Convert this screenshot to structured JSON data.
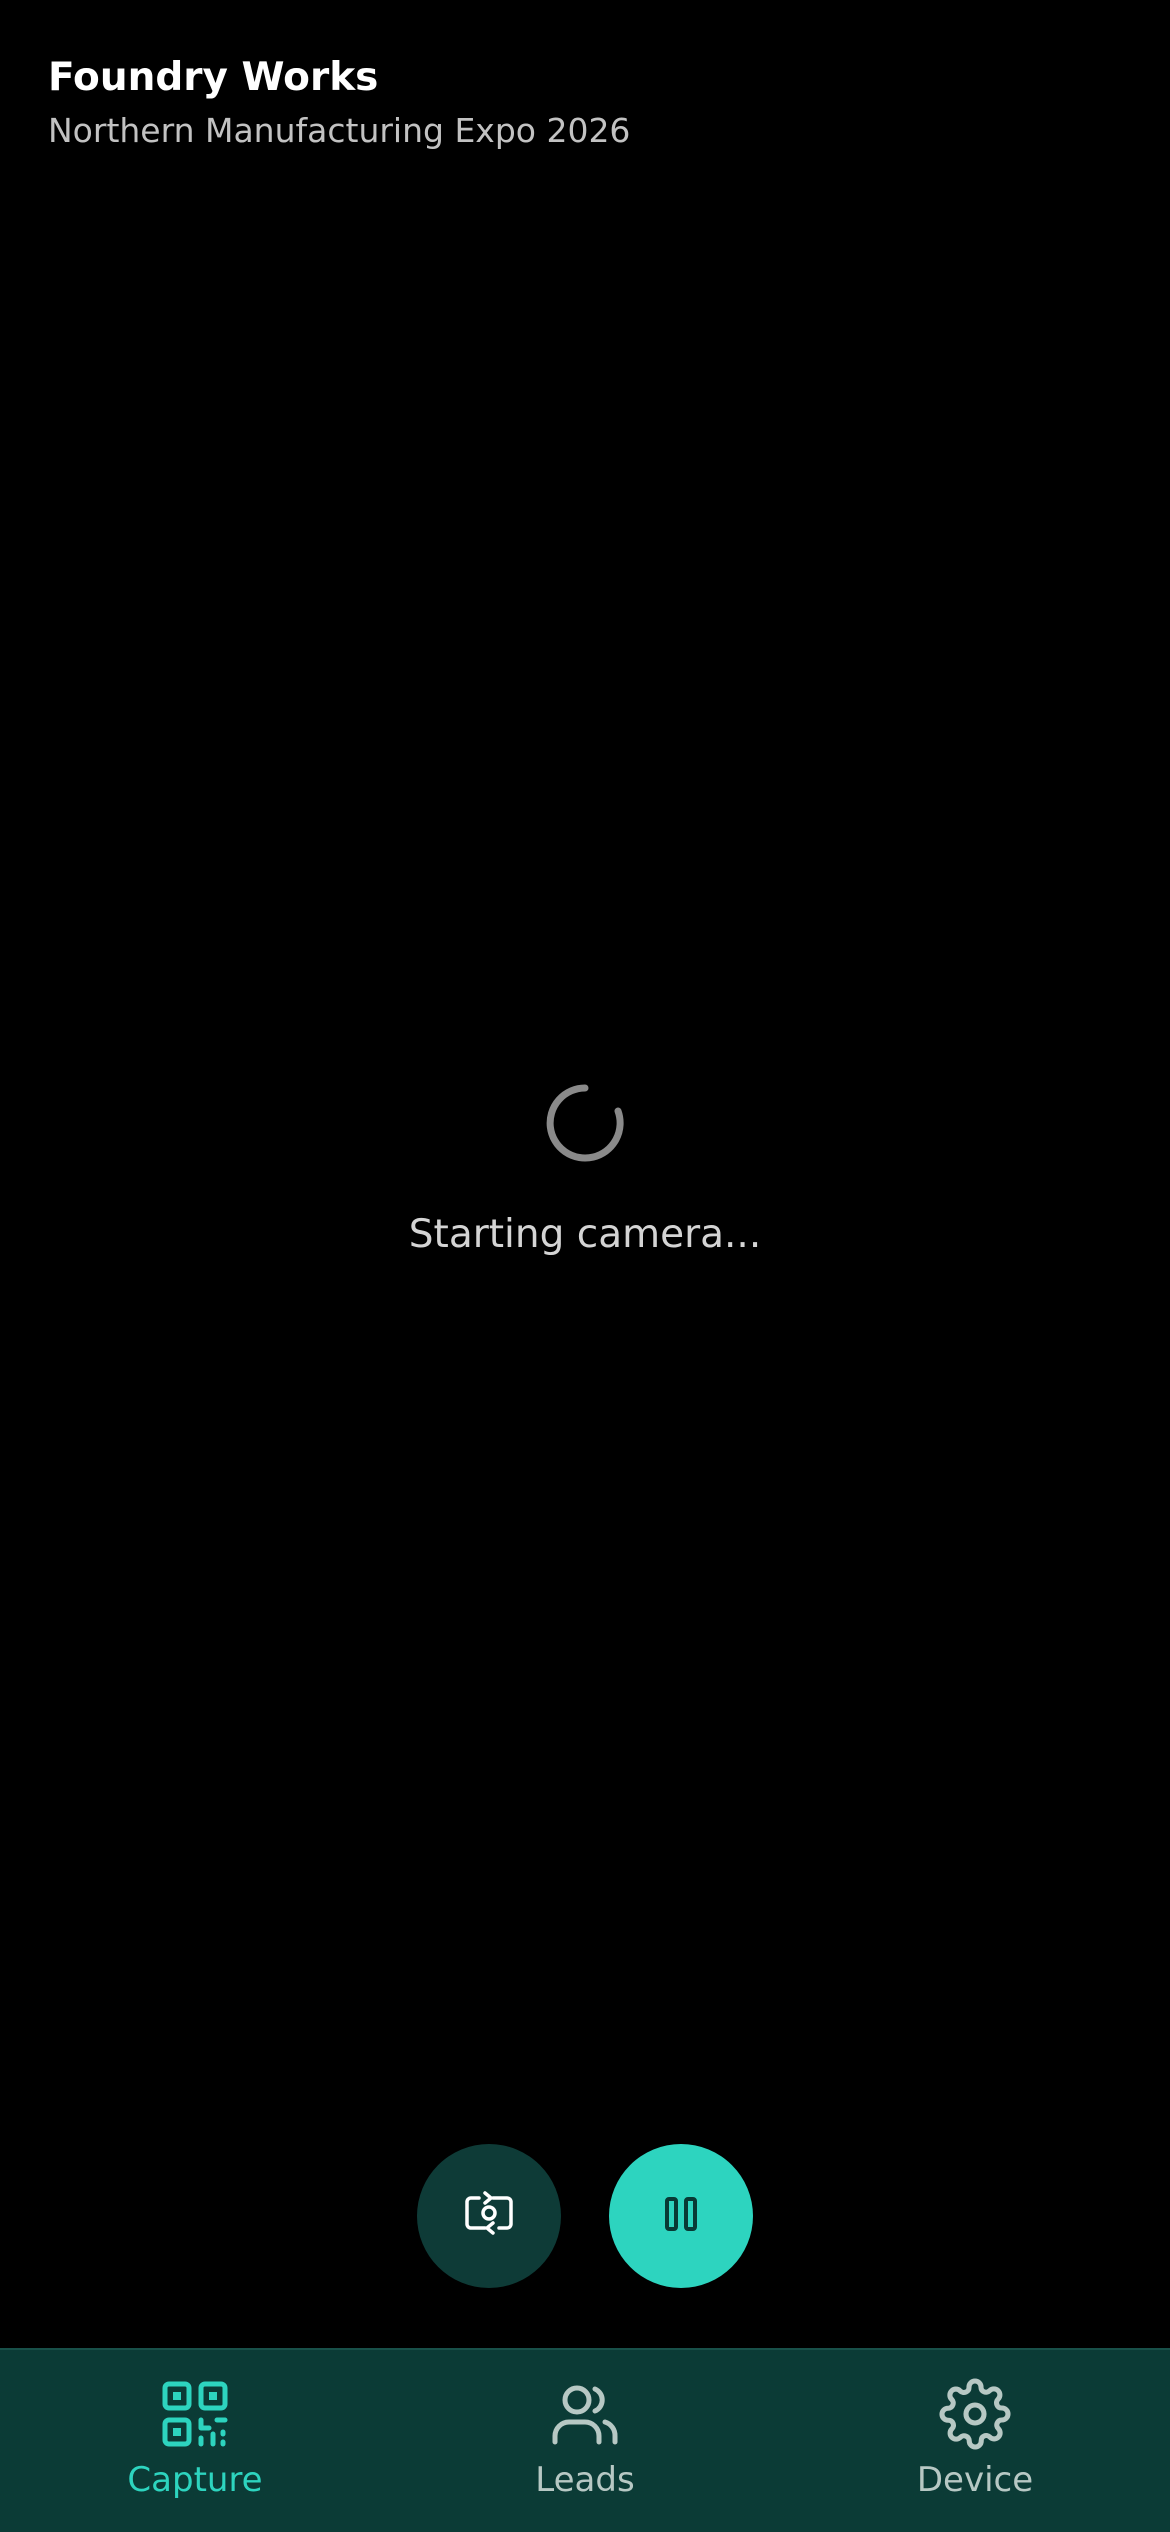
{
  "header": {
    "title": "Foundry Works",
    "subtitle": "Northern Manufacturing Expo 2026"
  },
  "camera": {
    "status_text": "Starting camera..."
  },
  "controls": {
    "flip_icon": "camera-switch-icon",
    "pause_icon": "pause-icon"
  },
  "tabs": [
    {
      "label": "Capture",
      "icon": "qr-code-icon",
      "active": true
    },
    {
      "label": "Leads",
      "icon": "users-icon",
      "active": false
    },
    {
      "label": "Device",
      "icon": "gear-icon",
      "active": false
    }
  ],
  "colors": {
    "accent": "#2dd4bf",
    "tabbar_bg": "#0b3b36",
    "flip_button_bg": "#0e3b37",
    "inactive_tab": "#b7c8c4"
  }
}
